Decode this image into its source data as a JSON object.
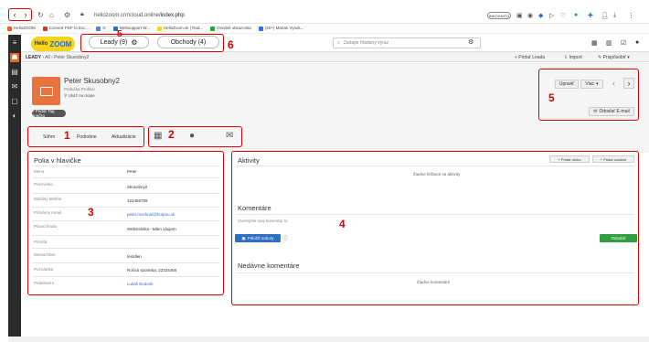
{
  "browser": {
    "url_host": "heliozoom.crmcloud.online",
    "url_path": "/index.php",
    "incognito": "INKOGNITO",
    "bookmarks": [
      {
        "label": "HelloZOOM",
        "color": "#e8651e"
      },
      {
        "label": "Convert PDF to Exc...",
        "color": "#d9332b"
      },
      {
        "label": "G",
        "color": "#4285f4"
      },
      {
        "label": "Websupport W...",
        "color": "#2a6fc9"
      },
      {
        "label": "HelloZoom.sk | Rad...",
        "color": "#f7d417"
      },
      {
        "label": "Ovcdné obrazovka",
        "color": "#27a33c"
      },
      {
        "label": "(20+) Marian Vysok...",
        "color": "#1877f2"
      }
    ]
  },
  "header": {
    "logo_hello": "Hello",
    "logo_zoom": "ZOOM",
    "tabs": [
      {
        "label": "Leady (9)"
      },
      {
        "label": "Obchody (4)"
      }
    ],
    "search_placeholder": "Zadajte hľadaný výraz"
  },
  "breadcrumb": {
    "module": "LEADY",
    "all": "All",
    "record": "Peter Skusobny2"
  },
  "actions": {
    "add_lead": "+ Pridať Leada",
    "import": "Import",
    "customize": "Prispôsobiť"
  },
  "record": {
    "name": "Peter Skusobny2",
    "subtitle": "Pridučka Profilov",
    "address": "Ukáž na mape",
    "add_tag": "+ Pridať Tag značku",
    "edit": "Upraviť",
    "more": "Viac",
    "send_email": "Odoslať E-mail"
  },
  "tabs": {
    "summary": "Súhrn",
    "details": "Podrobne",
    "updates": "Aktualizácie"
  },
  "annotations": [
    "1",
    "2",
    "3",
    "4",
    "5",
    "6"
  ],
  "header_fields": {
    "title": "Polia v hlavičke",
    "rows": [
      {
        "label": "Meno",
        "value": "Peter",
        "link": false
      },
      {
        "label": "Priezvisko",
        "value": "Skusobny2",
        "link": false
      },
      {
        "label": "Mobilný telefón",
        "value": "123456789",
        "link": false
      },
      {
        "label": "Primárny email",
        "value": "peter.mochnal@hotpou.sk",
        "link": true
      },
      {
        "label": "Pôvod leadu",
        "value": "Webstránka - Mám záujem",
        "link": false
      },
      {
        "label": "Priorita",
        "value": "",
        "link": false
      },
      {
        "label": "Mesto/Obec",
        "value": "testdlen",
        "link": false
      },
      {
        "label": "Poznámka",
        "value": "Ročná spotreba: 22334455",
        "link": false
      },
      {
        "label": "Pridelené k",
        "value": "Lukáš Bodonk",
        "link": true
      }
    ]
  },
  "activities": {
    "title": "Aktivity",
    "add_task": "+ Pridať úlohu",
    "add_event": "+ Pridať udalosť",
    "empty": "Žiadne blížiace sa aktivity"
  },
  "comments": {
    "title": "Komentáre",
    "placeholder": "Uverejnite svoj komentár tu",
    "attach": "Priložiť súbory",
    "send": "Odoslať"
  },
  "recent_comments": {
    "title": "Nedávne komentáre",
    "empty": "Žiadne komentáre"
  },
  "colors": {
    "annotation_red": "#dd0000",
    "brand_orange": "#e9733e",
    "logo_yellow": "#f7d417",
    "send_green": "#2e9e3e",
    "attach_blue": "#2f6fc4"
  }
}
